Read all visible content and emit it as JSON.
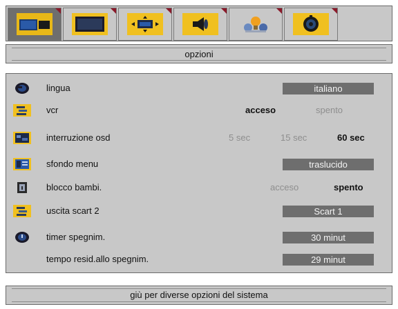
{
  "tabs": [
    {
      "icon": "picture-tab-icon",
      "active": true
    },
    {
      "icon": "screen-tab-icon",
      "active": false
    },
    {
      "icon": "size-tab-icon",
      "active": false
    },
    {
      "icon": "sound-tab-icon",
      "active": false
    },
    {
      "icon": "features-tab-icon",
      "active": false
    },
    {
      "icon": "install-tab-icon",
      "active": false
    }
  ],
  "header": {
    "title": "opzioni"
  },
  "rows": [
    {
      "label": "lingua",
      "icon": "globe-icon",
      "value": "italiano"
    },
    {
      "label": "vcr",
      "icon": "vcr-icon",
      "options": [
        "acceso",
        "spento"
      ],
      "selected": "acceso"
    },
    {
      "label": "interruzione osd",
      "icon": "osd-timeout-icon",
      "options": [
        "5 sec",
        "15 sec",
        "60 sec"
      ],
      "selected": "60 sec"
    },
    {
      "label": "sfondo menu",
      "icon": "menu-background-icon",
      "value": "traslucido"
    },
    {
      "label": "blocco bambi.",
      "icon": "child-lock-icon",
      "options": [
        "acceso",
        "spento"
      ],
      "selected": "spento"
    },
    {
      "label": "uscita scart 2",
      "icon": "scart-output-icon",
      "value": "Scart 1"
    },
    {
      "label": "timer spegnim.",
      "icon": "sleep-timer-icon",
      "value": "30  minut"
    },
    {
      "label": "tempo resid.allo spegnim.",
      "value": "29  minut"
    }
  ],
  "footer": {
    "hint": "giù per diverse opzioni del sistema"
  },
  "colors": {
    "accent": "#f0c020",
    "panel": "#c8c8c8",
    "value_box": "#6e6e6e",
    "tab_corner": "#8b1a2a"
  }
}
